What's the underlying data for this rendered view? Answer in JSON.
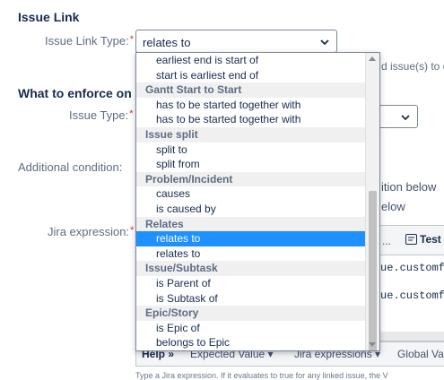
{
  "issue_link": {
    "section_title": "Issue Link",
    "type_label": "Issue Link Type:",
    "required_mark": "*",
    "selected_value": "relates to",
    "right_hint": "d issue(s) to ch"
  },
  "enforce": {
    "section_title": "What to enforce on I",
    "issue_type_label": "Issue Type:",
    "required_mark": "*",
    "condition_label": "Additional condition:",
    "condition_option_1": "ition below",
    "condition_option_2": "elow"
  },
  "jira_expression": {
    "label": "Jira expression:",
    "required_mark": "*",
    "toolbar_dots": "...",
    "test_button": "Test",
    "code_line_1": "ue.customf",
    "code_line_2": "ue.customf"
  },
  "help_bar": {
    "help_label": "Help »",
    "expected_value": "Expected Value",
    "jira_expressions": "Jira expressions",
    "global_values": "Global Va"
  },
  "footer_text": "Type a Jira expression. If it evaluates to true for any linked issue, the V",
  "dropdown": {
    "rows": [
      {
        "kind": "option",
        "label": "earliest end is start of"
      },
      {
        "kind": "option",
        "label": "start is earliest end of"
      },
      {
        "kind": "group",
        "label": "Gantt Start to Start"
      },
      {
        "kind": "option",
        "label": "has to be started together with"
      },
      {
        "kind": "option",
        "label": "has to be started together with"
      },
      {
        "kind": "group",
        "label": "Issue split"
      },
      {
        "kind": "option",
        "label": "split to"
      },
      {
        "kind": "option",
        "label": "split from"
      },
      {
        "kind": "group",
        "label": "Problem/Incident"
      },
      {
        "kind": "option",
        "label": "causes"
      },
      {
        "kind": "option",
        "label": "is caused by"
      },
      {
        "kind": "group",
        "label": "Relates"
      },
      {
        "kind": "option",
        "label": "relates to",
        "selected": true
      },
      {
        "kind": "option",
        "label": "relates to"
      },
      {
        "kind": "group",
        "label": "Issue/Subtask"
      },
      {
        "kind": "option",
        "label": "is Parent of"
      },
      {
        "kind": "option",
        "label": "is Subtask of"
      },
      {
        "kind": "group",
        "label": "Epic/Story"
      },
      {
        "kind": "option",
        "label": "is Epic of"
      },
      {
        "kind": "option",
        "label": "belongs to Epic"
      }
    ]
  },
  "colors": {
    "selected_row": "#1e90ff",
    "group_header_bg": "#f0f0f0",
    "required": "#de350b"
  }
}
